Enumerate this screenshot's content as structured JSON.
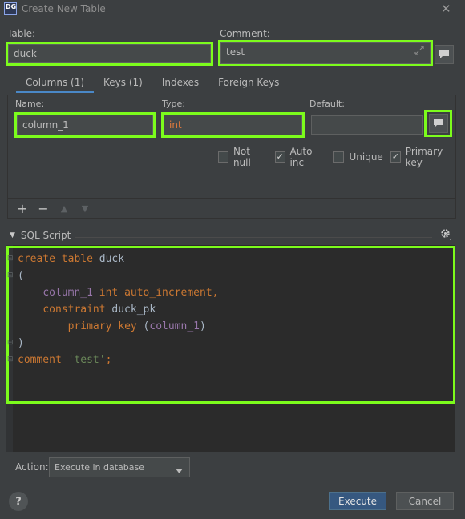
{
  "window": {
    "icon_text": "DG",
    "title": "Create New Table",
    "close_glyph": "✕"
  },
  "table": {
    "label": "Table:",
    "value": "duck"
  },
  "comment": {
    "label": "Comment:",
    "value": "test",
    "expand_icon": "expand-icon",
    "note_icon": "comment-icon"
  },
  "tabs": [
    {
      "label": "Columns (1)",
      "active": true
    },
    {
      "label": "Keys (1)",
      "active": false
    },
    {
      "label": "Indexes",
      "active": false
    },
    {
      "label": "Foreign Keys",
      "active": false
    }
  ],
  "column": {
    "name_label": "Name:",
    "name_value": "column_1",
    "type_label": "Type:",
    "type_value": "int",
    "default_label": "Default:",
    "default_value": ""
  },
  "flags": [
    {
      "label": "Not null",
      "checked": false
    },
    {
      "label": "Auto inc",
      "checked": true
    },
    {
      "label": "Unique",
      "checked": false
    },
    {
      "label": "Primary key",
      "checked": true
    }
  ],
  "column_toolbar": {
    "add": "+",
    "remove": "−",
    "up": "▲",
    "down": "▼"
  },
  "sql_script": {
    "header": "SQL Script",
    "lines": [
      [
        {
          "t": "create table ",
          "c": "kw"
        },
        {
          "t": "duck",
          "c": "id"
        }
      ],
      [
        {
          "t": "(",
          "c": "id"
        }
      ],
      [
        {
          "t": "    ",
          "c": "id"
        },
        {
          "t": "column_1 ",
          "c": "col"
        },
        {
          "t": "int auto_increment,",
          "c": "kw"
        }
      ],
      [
        {
          "t": "    ",
          "c": "id"
        },
        {
          "t": "constraint ",
          "c": "kw"
        },
        {
          "t": "duck_pk",
          "c": "id"
        }
      ],
      [
        {
          "t": "        ",
          "c": "id"
        },
        {
          "t": "primary key ",
          "c": "kw"
        },
        {
          "t": "(",
          "c": "id"
        },
        {
          "t": "column_1",
          "c": "col"
        },
        {
          "t": ")",
          "c": "id"
        }
      ],
      [
        {
          "t": ")",
          "c": "id"
        }
      ],
      [
        {
          "t": "comment ",
          "c": "kw"
        },
        {
          "t": "'test'",
          "c": "str"
        },
        {
          "t": ";",
          "c": "kw"
        }
      ]
    ]
  },
  "action": {
    "label": "Action:",
    "selected": "Execute in database"
  },
  "buttons": {
    "help": "?",
    "execute": "Execute",
    "cancel": "Cancel"
  },
  "colors": {
    "highlight": "#7cfc1c",
    "accent": "#365880",
    "tab_underline": "#4a88c7"
  }
}
